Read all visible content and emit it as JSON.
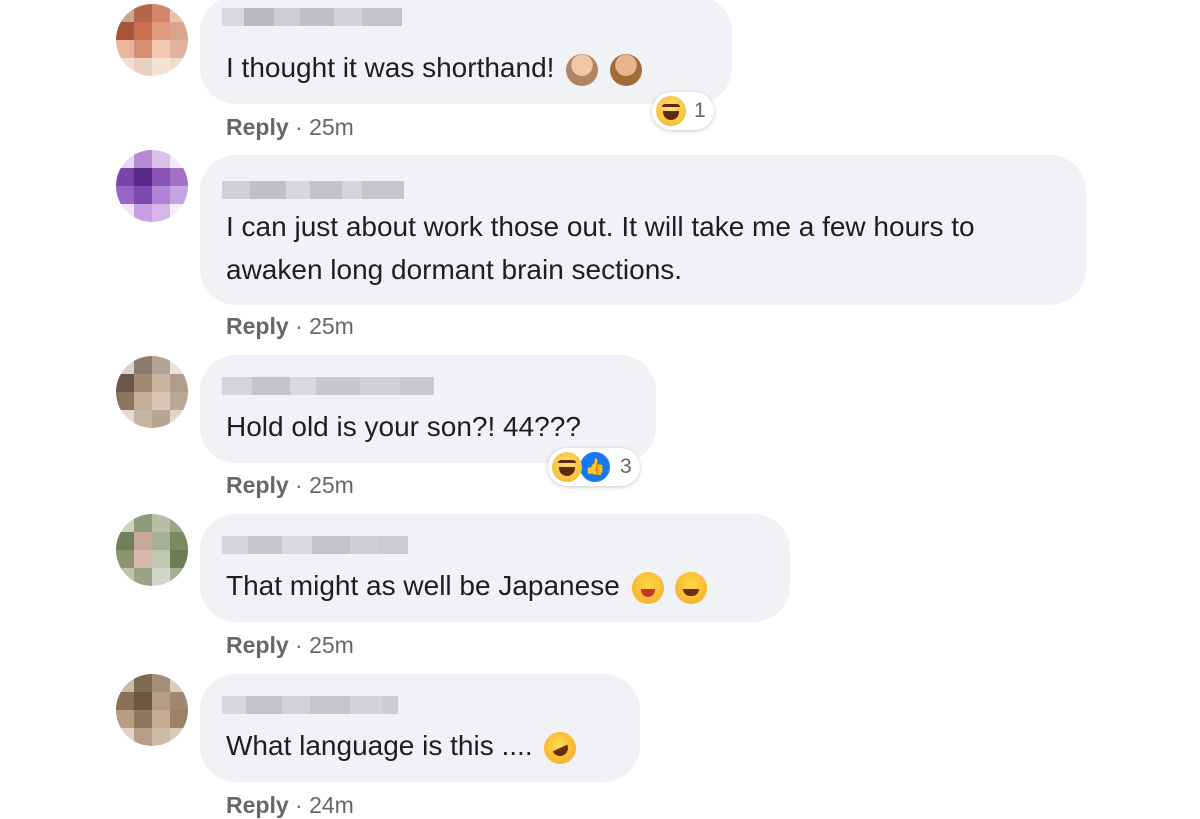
{
  "comments": [
    {
      "text": "I thought it was shorthand!",
      "emoji_icons": [
        "woman-shrugging-icon",
        "woman-shrugging-icon"
      ],
      "reply_label": "Reply",
      "time": "· 25m",
      "reactions": {
        "icons": [
          "haha-reaction-icon"
        ],
        "count": "1"
      }
    },
    {
      "text": "I can just about work those out. It will take me a few hours to awaken long dormant brain sections.",
      "reply_label": "Reply",
      "time": "· 25m"
    },
    {
      "text": "Hold old is your son?! 44???",
      "reply_label": "Reply",
      "time": "· 25m",
      "reactions": {
        "icons": [
          "haha-reaction-icon",
          "like-reaction-icon"
        ],
        "count": "3"
      }
    },
    {
      "text": "That might as well be Japanese",
      "emoji_icons": [
        "winking-tongue-face-icon",
        "zany-face-icon"
      ],
      "reply_label": "Reply",
      "time": "· 25m"
    },
    {
      "text": "What language is this ....",
      "emoji_icons": [
        "rolling-on-floor-laughing-icon"
      ],
      "reply_label": "Reply",
      "time": "· 24m"
    }
  ],
  "colors": {
    "bubble": "#f0f2f5",
    "text": "#1c1e21",
    "meta": "#65676b",
    "like_blue": "#1877f2"
  }
}
